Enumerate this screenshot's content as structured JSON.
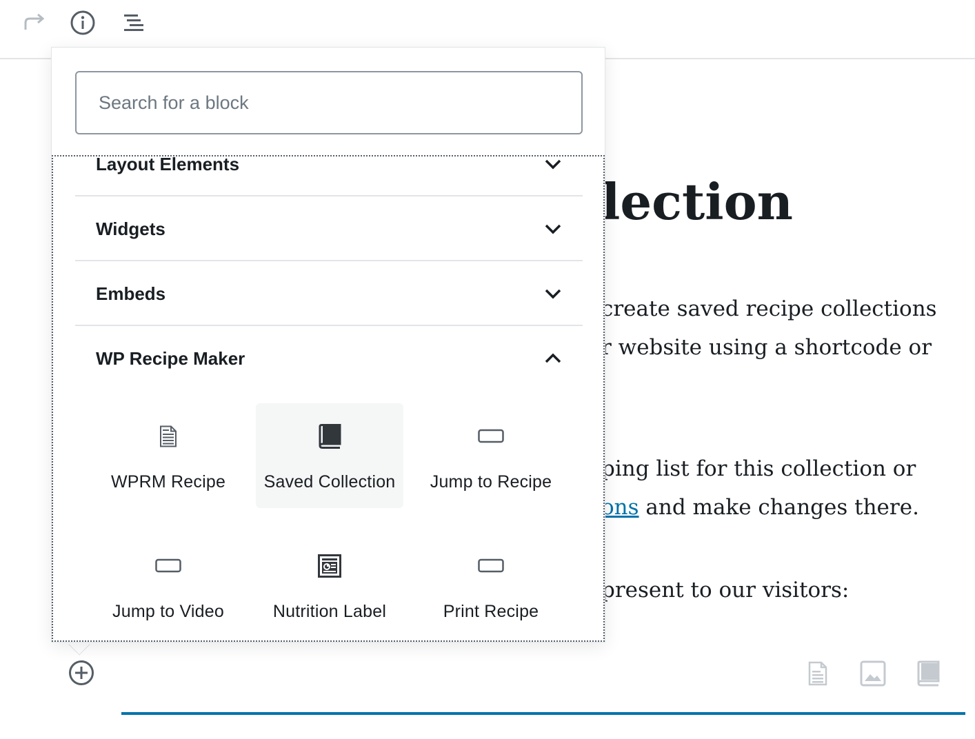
{
  "toolbar": {
    "redo_icon": "redo-icon",
    "info_icon": "info-icon",
    "outline_icon": "list-outline-icon"
  },
  "content": {
    "heading_fragment": "lection",
    "para1_line1": "create saved recipe collections",
    "para1_line2": "r website using a shortcode or",
    "para2_line1": "ping list for this collection or",
    "para2_link": "ons",
    "para2_line2_rest": " and make changes there.",
    "para3_line1": "present to our visitors:"
  },
  "inserter": {
    "search_placeholder": "Search for a block",
    "panels": [
      {
        "title": "Layout Elements",
        "expanded": false
      },
      {
        "title": "Widgets",
        "expanded": false
      },
      {
        "title": "Embeds",
        "expanded": false
      },
      {
        "title": "WP Recipe Maker",
        "expanded": true
      }
    ],
    "blocks": [
      {
        "label": "WPRM Recipe",
        "icon": "document-icon",
        "selected": false
      },
      {
        "label": "Saved Collection",
        "icon": "book-icon",
        "selected": true
      },
      {
        "label": "Jump to Recipe",
        "icon": "button-icon",
        "selected": false
      },
      {
        "label": "Jump to Video",
        "icon": "button-icon",
        "selected": false
      },
      {
        "label": "Nutrition Label",
        "icon": "nutrition-label-icon",
        "selected": false
      },
      {
        "label": "Print Recipe",
        "icon": "button-icon",
        "selected": false
      }
    ]
  },
  "colors": {
    "accent": "#0073aa",
    "text": "#191e23",
    "icon": "#555d66",
    "border": "#e2e4e7"
  }
}
